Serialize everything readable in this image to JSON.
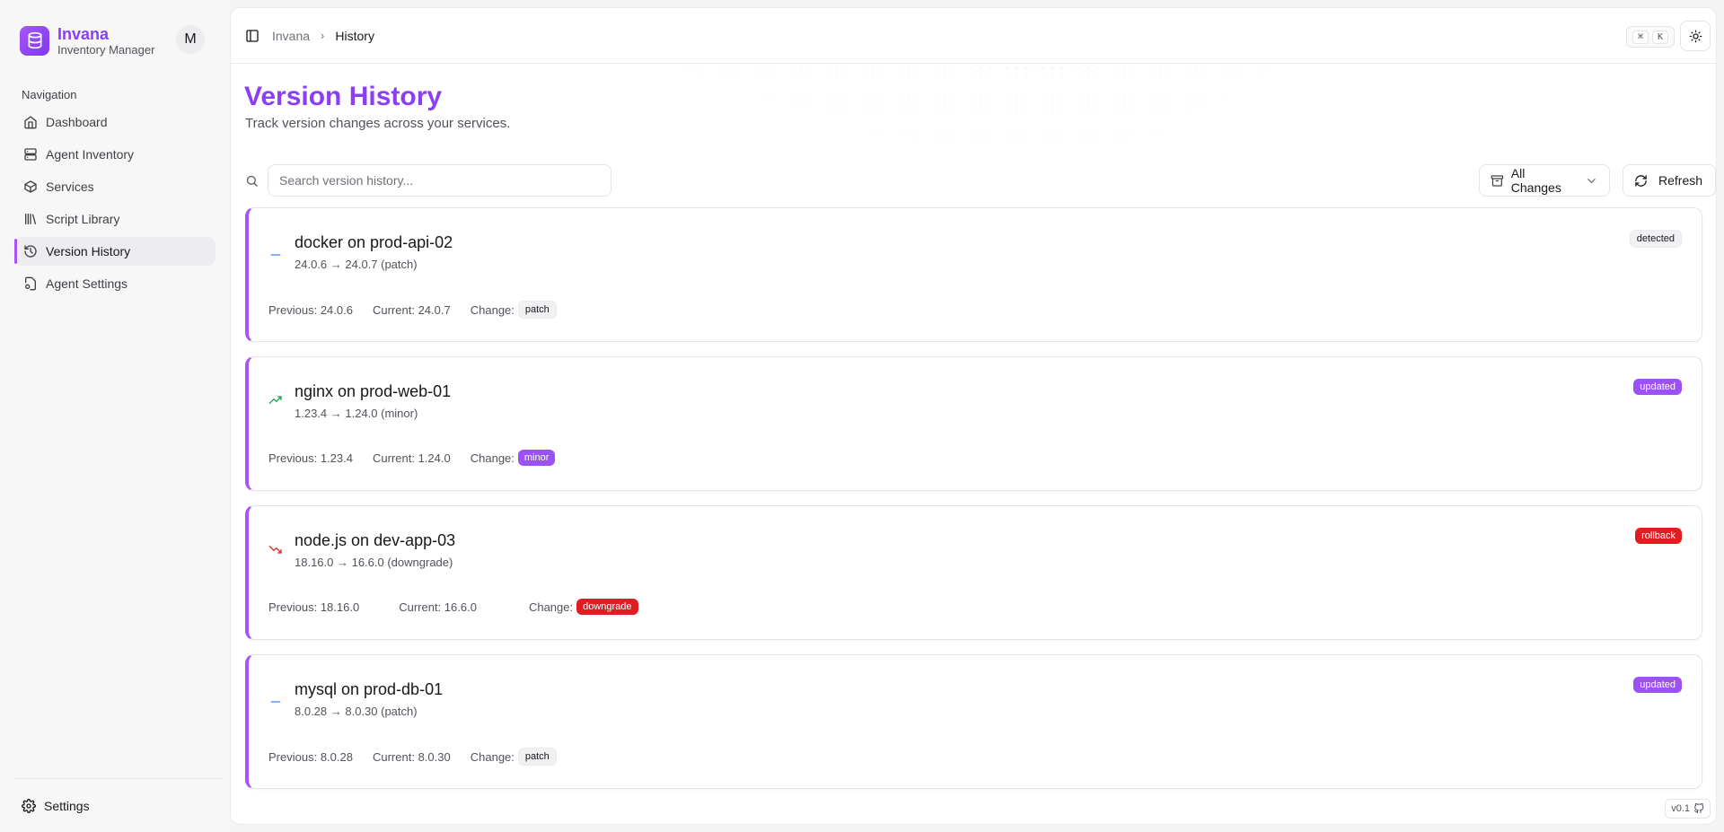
{
  "brand": {
    "name": "Invana",
    "subtitle": "Inventory Manager",
    "avatar_initial": "M"
  },
  "sidebar": {
    "heading": "Navigation",
    "items": [
      {
        "label": "Dashboard",
        "icon": "home-icon",
        "active": false
      },
      {
        "label": "Agent Inventory",
        "icon": "server-icon",
        "active": false
      },
      {
        "label": "Services",
        "icon": "box-icon",
        "active": false
      },
      {
        "label": "Script Library",
        "icon": "library-icon",
        "active": false
      },
      {
        "label": "Version History",
        "icon": "history-icon",
        "active": true
      },
      {
        "label": "Agent Settings",
        "icon": "file-cog-icon",
        "active": false
      }
    ],
    "footer_label": "Settings"
  },
  "topbar": {
    "breadcrumb": [
      "Invana",
      "History"
    ],
    "shortcut_keys": [
      "⌘",
      "K"
    ]
  },
  "page": {
    "title": "Version History",
    "subtitle": "Track version changes across your services.",
    "search_placeholder": "Search version history...",
    "filter_label": "All Changes",
    "refresh_label": "Refresh"
  },
  "labels": {
    "previous": "Previous:",
    "current": "Current:",
    "change": "Change:"
  },
  "colors": {
    "accent": "#a855f7",
    "purple_badge": "#9b51f5",
    "red_badge": "#e11d24"
  },
  "entries": [
    {
      "title": "docker on prod-api-02",
      "summary": "24.0.6 → 24.0.7 (patch)",
      "previous": "24.0.6",
      "current": "24.0.7",
      "change": "patch",
      "status": "detected",
      "trend_icon": "minus-icon"
    },
    {
      "title": "nginx on prod-web-01",
      "summary": "1.23.4 → 1.24.0 (minor)",
      "previous": "1.23.4",
      "current": "1.24.0",
      "change": "minor",
      "status": "updated",
      "trend_icon": "trending-up-icon"
    },
    {
      "title": "node.js on dev-app-03",
      "summary": "18.16.0 → 16.6.0 (downgrade)",
      "previous": "18.16.0",
      "current": "16.6.0",
      "change": "downgrade",
      "status": "rollback",
      "trend_icon": "trending-down-icon"
    },
    {
      "title": "mysql on prod-db-01",
      "summary": "8.0.28 → 8.0.30 (patch)",
      "previous": "8.0.28",
      "current": "8.0.30",
      "change": "patch",
      "status": "updated",
      "trend_icon": "minus-icon"
    }
  ],
  "version_badge": "v0.1"
}
